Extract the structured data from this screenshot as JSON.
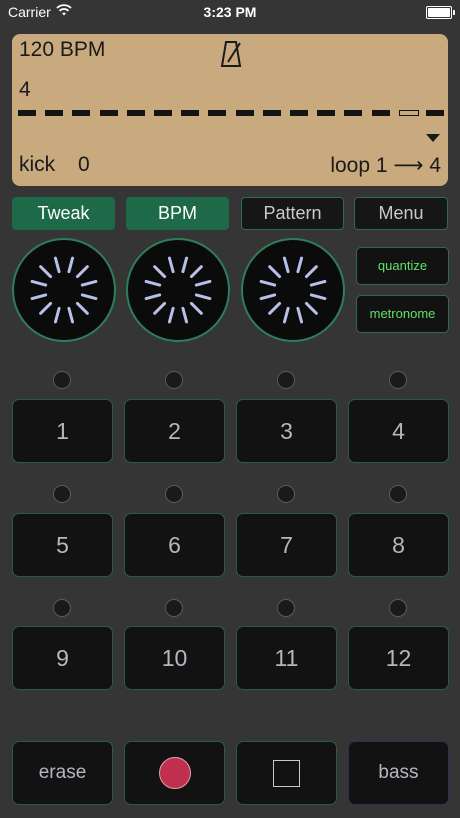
{
  "status_bar": {
    "carrier": "Carrier",
    "time": "3:23 PM"
  },
  "display": {
    "bpm": "120 BPM",
    "beats": "4",
    "metronome_icon": "metronome-icon",
    "pattern_steps": 16,
    "current_step": 14,
    "instrument": "kick",
    "instrument_value": "0",
    "loop": "loop 1 ⟶ 4"
  },
  "tabs": [
    {
      "label": "Tweak",
      "active": true
    },
    {
      "label": "BPM",
      "active": true
    },
    {
      "label": "Pattern",
      "active": false
    },
    {
      "label": "Menu",
      "active": false
    }
  ],
  "knobs": [
    {
      "name": "knob-1"
    },
    {
      "name": "knob-2"
    },
    {
      "name": "knob-3"
    }
  ],
  "side_buttons": {
    "quantize": "quantize",
    "metronome": "metronome"
  },
  "pads": [
    "1",
    "2",
    "3",
    "4",
    "5",
    "6",
    "7",
    "8",
    "9",
    "10",
    "11",
    "12"
  ],
  "transport": {
    "erase": "erase",
    "record_icon": "record-icon",
    "stop_icon": "stop-icon",
    "bass": "bass"
  },
  "colors": {
    "background": "#353535",
    "lcd": "#c9aa7e",
    "accent_green": "#1e6a48",
    "text_green": "#5fe06a",
    "record_red": "#c0304e"
  }
}
